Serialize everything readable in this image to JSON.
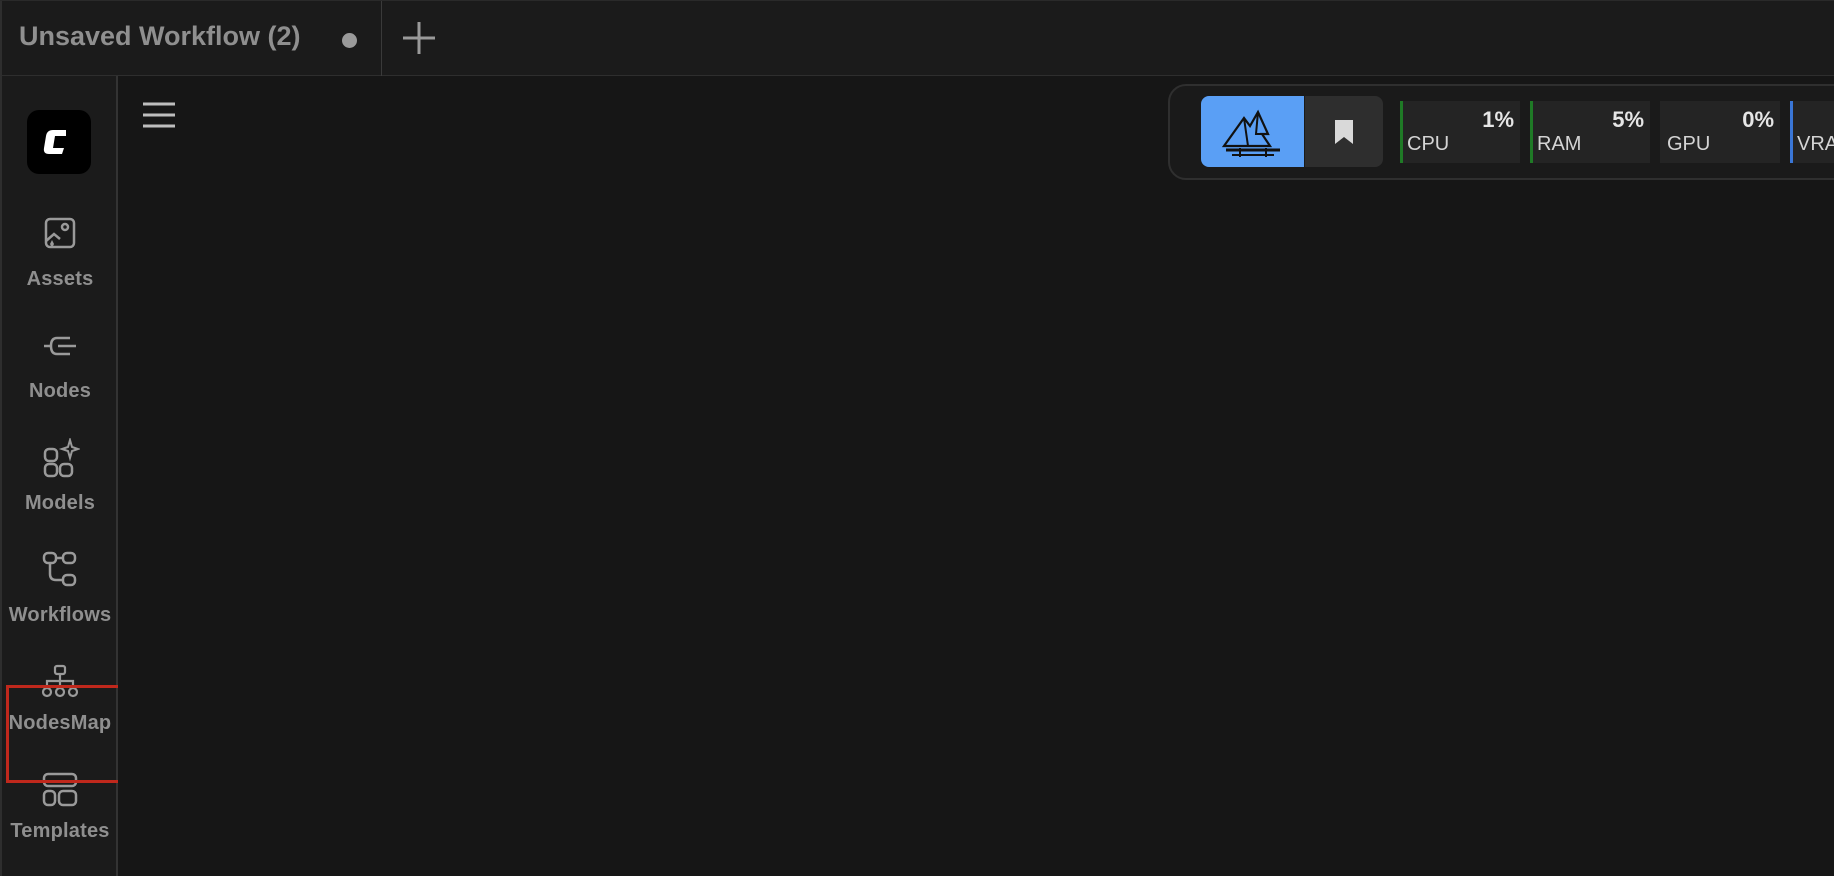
{
  "tabbar": {
    "tab_title": "Unsaved Workflow (2)",
    "unsaved_indicator": "dot-icon",
    "new_tab_icon": "plus-icon"
  },
  "sidebar": {
    "logo_icon": "comfy-logo-icon",
    "items": [
      {
        "label": "Assets",
        "icon": "image-sparkle-icon"
      },
      {
        "label": "Nodes",
        "icon": "node-plug-icon"
      },
      {
        "label": "Models",
        "icon": "grid-sparkle-icon"
      },
      {
        "label": "Workflows",
        "icon": "workflow-branch-icon"
      },
      {
        "label": "NodesMap",
        "icon": "hierarchy-icon"
      },
      {
        "label": "Templates",
        "icon": "layout-template-icon"
      }
    ],
    "highlighted_item": "Templates",
    "highlight_color": "#c0281c"
  },
  "canvas": {
    "menu_icon": "hamburger-menu-icon"
  },
  "toolbar": {
    "logo_button_icon": "mountain-logo-icon",
    "bookmark_icon": "bookmark-icon",
    "accent_color": "#5a9ff5",
    "stats": [
      {
        "name": "CPU",
        "value": "1%"
      },
      {
        "name": "RAM",
        "value": "5%"
      },
      {
        "name": "GPU",
        "value": "0%"
      },
      {
        "name": "VRA",
        "value": ""
      }
    ]
  }
}
